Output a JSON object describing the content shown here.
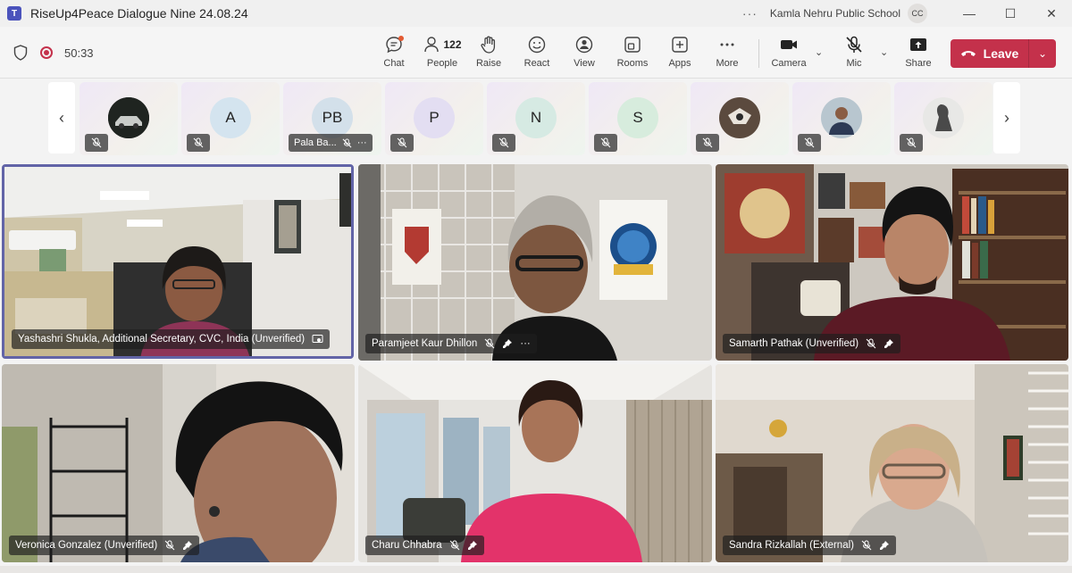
{
  "window": {
    "title": "RiseUp4Peace Dialogue Nine 24.08.24",
    "app_logo": "T",
    "more_dots": "···",
    "organization": "Kamla Nehru Public School",
    "account_initials": "CC",
    "minimize_glyph": "—",
    "maximize_glyph": "☐",
    "close_glyph": "✕"
  },
  "toolbar": {
    "elapsed": "50:33",
    "chat_label": "Chat",
    "people_label": "People",
    "people_count": "122",
    "raise_label": "Raise",
    "react_label": "React",
    "view_label": "View",
    "rooms_label": "Rooms",
    "apps_label": "Apps",
    "more_label": "More",
    "camera_label": "Camera",
    "mic_label": "Mic",
    "share_label": "Share",
    "leave_label": "Leave",
    "chevron_glyph": "⌄",
    "more_glyph": "···"
  },
  "strip": {
    "prev_glyph": "‹",
    "next_glyph": "›",
    "thumbnails": [
      {
        "initials": "",
        "photo": "car-photo"
      },
      {
        "initials": "A",
        "color": "#d4e4ef"
      },
      {
        "initials": "PB",
        "color": "#d3e0ea",
        "name": "Pala Ba..."
      },
      {
        "initials": "P",
        "color": "#e3def2"
      },
      {
        "initials": "N",
        "color": "#d6eae3"
      },
      {
        "initials": "S",
        "color": "#d7ecdd"
      },
      {
        "initials": "",
        "photo": "graphic-photo"
      },
      {
        "initials": "",
        "photo": "person-photo"
      },
      {
        "initials": "",
        "photo": "silhouette-photo"
      }
    ]
  },
  "tiles": [
    {
      "name": "Yashashri Shukla, Additional Secretary, CVC, India (Unverified)",
      "extra_icon": "screen-share-icon"
    },
    {
      "name": "Paramjeet Kaur Dhillon",
      "extra_icon": "more"
    },
    {
      "name": "Samarth Pathak (Unverified)"
    },
    {
      "name": "Veronica Gonzalez (Unverified)"
    },
    {
      "name": "Charu Chhabra"
    },
    {
      "name": "Sandra Rizkallah (External)"
    }
  ],
  "colors": {
    "accent": "#6264a7",
    "leave": "#c4314b",
    "recording": "#c4314b"
  }
}
